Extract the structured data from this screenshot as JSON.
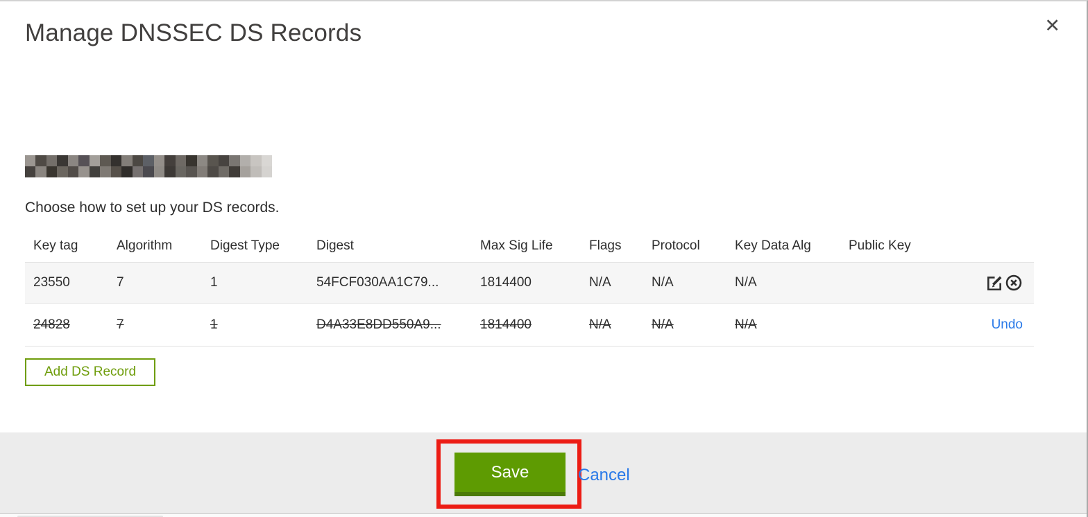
{
  "modal": {
    "title": "Manage DNSSEC DS Records",
    "close_icon": "✕"
  },
  "domain": {
    "redacted": true,
    "redacted_pixels": [
      "#9b9691",
      "#4f4a45",
      "#746f6a",
      "#3a3734",
      "#8b8682",
      "#565156",
      "#a39f9a",
      "#5e5952",
      "#34312e",
      "#837e79",
      "#4c4843",
      "#5d6066",
      "#948f8a",
      "#443f3c",
      "#6e6964",
      "#38342f",
      "#8d8984",
      "#59554f",
      "#474340",
      "#7a7672",
      "#b2afab",
      "#c8c5c1",
      "#d9d7d4",
      "#45413e",
      "#8a8580",
      "#39352f",
      "#6b665f",
      "#514c48",
      "#97928d",
      "#42403d",
      "#7f7a74",
      "#565049",
      "#302d2a",
      "#767170",
      "#4b4a4f",
      "#8f8b86",
      "#3d3936",
      "#696661",
      "#585450",
      "#827d78",
      "#4e4a46",
      "#6f6b66",
      "#403c38",
      "#a5a19c",
      "#c0bdb9",
      "#d5d3d0"
    ]
  },
  "instruction": "Choose how to set up your DS records.",
  "table": {
    "headers": [
      "Key tag",
      "Algorithm",
      "Digest Type",
      "Digest",
      "Max Sig Life",
      "Flags",
      "Protocol",
      "Key Data Alg",
      "Public Key"
    ],
    "rows": [
      {
        "cells": [
          "23550",
          "7",
          "1",
          "54FCF030AA1C79...",
          "1814400",
          "N/A",
          "N/A",
          "N/A",
          ""
        ],
        "deleted": false
      },
      {
        "cells": [
          "24828",
          "7",
          "1",
          "D4A33E8DD550A9...",
          "1814400",
          "N/A",
          "N/A",
          "N/A",
          ""
        ],
        "deleted": true,
        "undo_label": "Undo"
      }
    ]
  },
  "buttons": {
    "add_record": "Add DS Record",
    "save": "Save",
    "cancel": "Cancel"
  },
  "colors": {
    "accent_green": "#5e9b02",
    "accent_green_dark": "#4c7b08",
    "outline_green": "#6f9d0c",
    "link_blue": "#2979e8",
    "annotation_red": "#ec1c14"
  }
}
